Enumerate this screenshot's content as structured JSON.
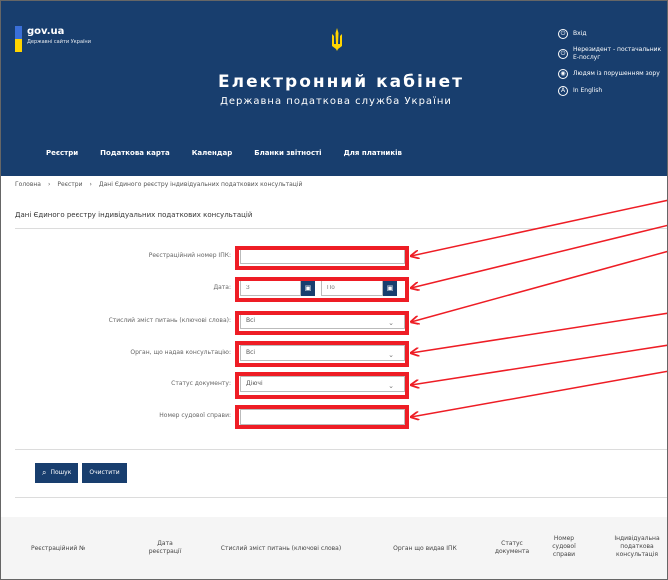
{
  "header": {
    "brand_name": "gov.ua",
    "brand_sub": "Державні сайти України",
    "title": "Електронний кабінет",
    "subtitle": "Державна податкова служба України",
    "right_menu": [
      "Вхід",
      "Нерезидент - постачальник Е-послуг",
      "Людям із порушенням зору",
      "In English"
    ]
  },
  "nav": [
    "Реєстри",
    "Податкова карта",
    "Календар",
    "Бланки звітності",
    "Для платників"
  ],
  "breadcrumb": [
    "Головна",
    "Реєстри",
    "Дані Єдиного реєстру індивідуальних податкових консультацій"
  ],
  "page": {
    "heading": "Дані Єдиного реєстру індивідуальних податкових консультацій"
  },
  "form": {
    "reg_number_label": "Реєстраційний номер ІПК:",
    "date_label": "Дата:",
    "date_from_placeholder": "З",
    "date_to_placeholder": "По",
    "keywords_label": "Стислий зміст питань (ключові слова):",
    "keywords_value": "Всі",
    "org_label": "Орган, що надав консультацію:",
    "org_value": "Всі",
    "status_label": "Статус документу:",
    "status_value": "Діючі",
    "case_label": "Номер судової справи:"
  },
  "buttons": {
    "search": "Пошук",
    "clear": "Очистити"
  },
  "table": {
    "headers": [
      "Реєстраційний №",
      "Дата реєстрації",
      "Стислий зміст питань (ключові слова)",
      "Орган що видав ІПК",
      "Статус документа",
      "Номер судової справи",
      "Індивідуальна податкова консультація"
    ]
  },
  "colors": {
    "header_bg": "#183e6e",
    "annotation_red": "#ee1d25",
    "ua_blue": "#3a6fd8",
    "ua_yellow": "#ffd400"
  }
}
